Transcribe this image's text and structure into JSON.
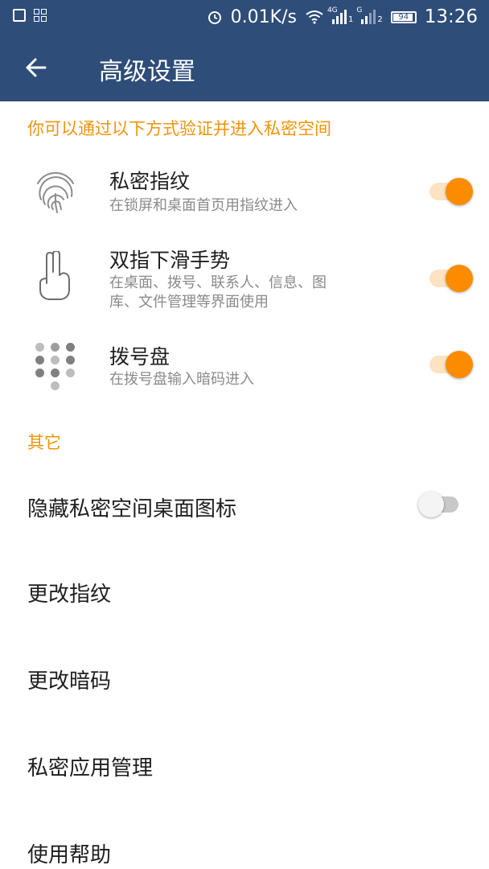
{
  "status_bar": {
    "net_speed": "0.01K/s",
    "sim1_type": "4G",
    "sim1_index": "1",
    "sim2_type": "G",
    "sim2_index": "2",
    "battery": "94",
    "time": "13:26",
    "icons": [
      "image-icon",
      "apps-icon",
      "alarm-icon",
      "wifi-icon",
      "signal-icon",
      "signal-icon",
      "battery-icon"
    ]
  },
  "app_bar": {
    "back_icon": "arrow-back-icon",
    "title": "高级设置"
  },
  "verify_section": {
    "header": "你可以通过以下方式验证并进入私密空间",
    "items": [
      {
        "icon": "fingerprint-icon",
        "title": "私密指纹",
        "subtitle": "在锁屏和桌面首页用指纹进入",
        "enabled": true
      },
      {
        "icon": "two-finger-swipe-icon",
        "title": "双指下滑手势",
        "subtitle_line1": "在桌面、拨号、联系人、信息、图",
        "subtitle_line2": "库、文件管理等界面使用",
        "enabled": true
      },
      {
        "icon": "dialpad-icon",
        "title": "拨号盘",
        "subtitle": "在拨号盘输入暗码进入",
        "enabled": true
      }
    ]
  },
  "other_section": {
    "header": "其它",
    "hide_icon": {
      "label": "隐藏私密空间桌面图标",
      "enabled": false
    },
    "items": [
      "更改指纹",
      "更改暗码",
      "私密应用管理",
      "使用帮助"
    ]
  },
  "colors": {
    "app_bar": "#2e4d78",
    "accent": "#fb8c00",
    "section_header": "#f0940a"
  }
}
